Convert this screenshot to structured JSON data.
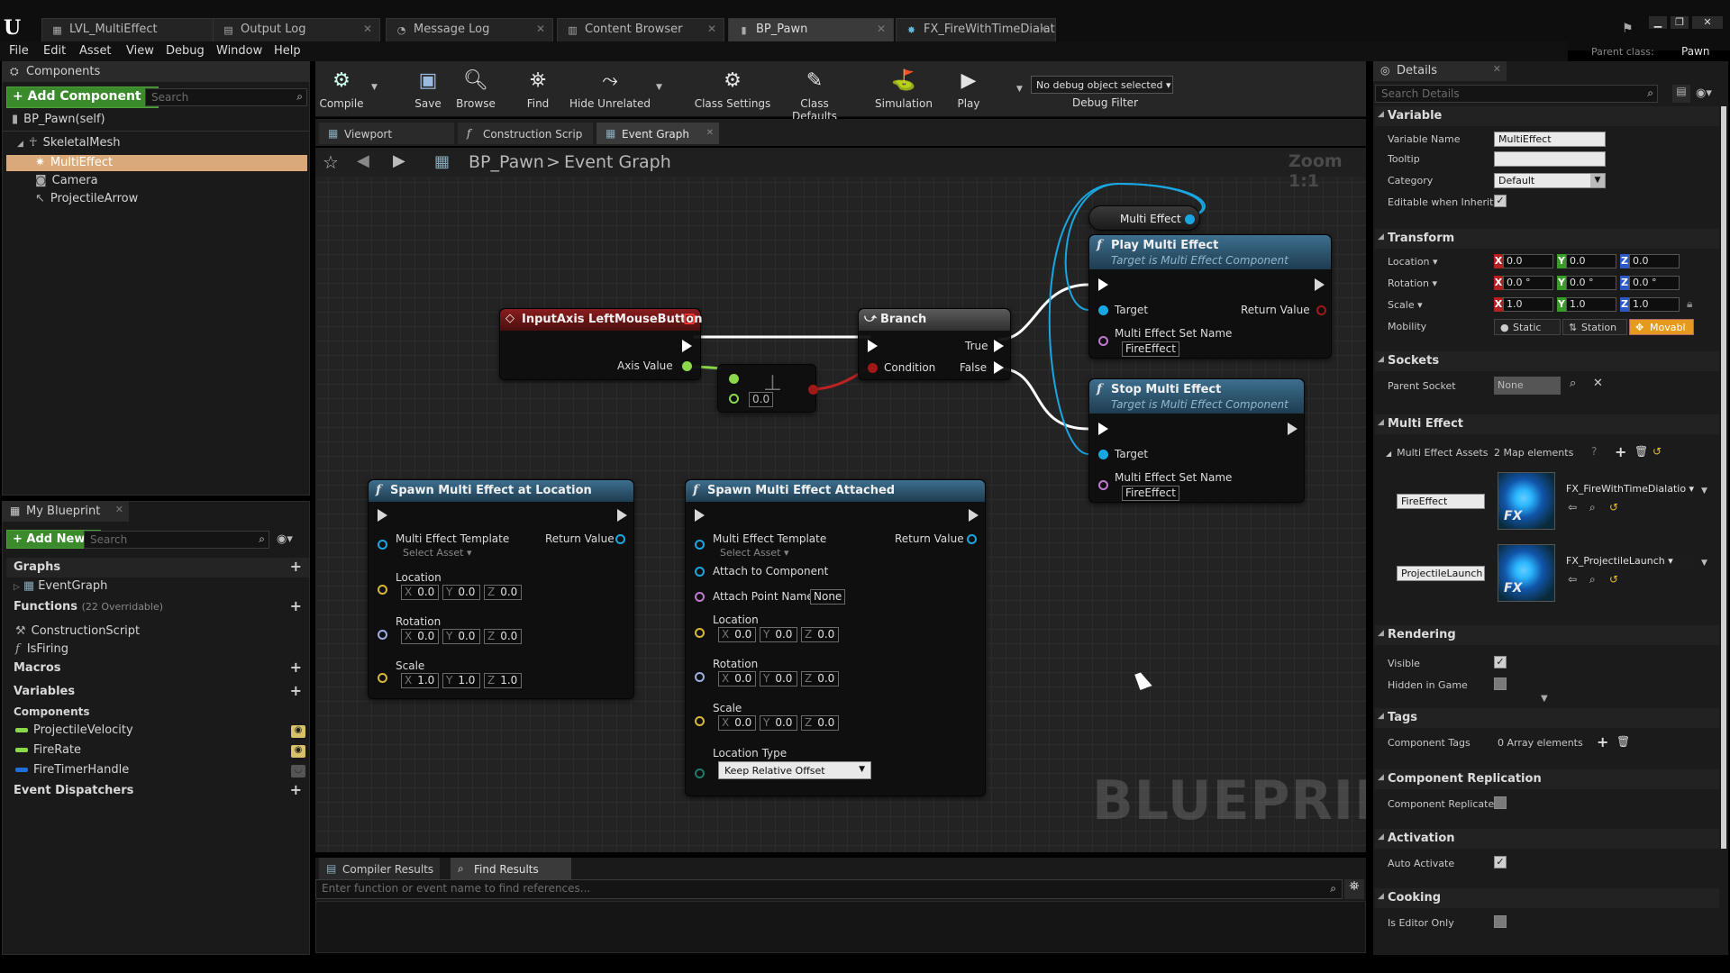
{
  "titlebar": {
    "logo": "U",
    "parent_label": "Parent class:",
    "parent_value": "Pawn",
    "tabs": [
      {
        "label": "LVL_MultiEffect",
        "icon": "level-icon"
      },
      {
        "label": "Output Log",
        "icon": "log-icon"
      },
      {
        "label": "Message Log",
        "icon": "message-log-icon"
      },
      {
        "label": "Content Browser",
        "icon": "content-browser-icon"
      },
      {
        "label": "BP_Pawn",
        "icon": "blueprint-icon"
      },
      {
        "label": "FX_FireWithTimeDialation",
        "icon": "fx-icon"
      }
    ]
  },
  "menu": [
    "File",
    "Edit",
    "Asset",
    "View",
    "Debug",
    "Window",
    "Help"
  ],
  "components": {
    "header": "Components",
    "add_button": "+ Add Component ▾",
    "search_placeholder": "Search",
    "self": "BP_Pawn(self)",
    "tree": [
      "SkeletalMesh",
      "MultiEffect",
      "Camera",
      "ProjectileArrow"
    ]
  },
  "my_blueprint": {
    "header": "My Blueprint",
    "add_button": "+ Add New ▾",
    "search_placeholder": "Search",
    "graphs_label": "Graphs",
    "event_graph": "EventGraph",
    "functions_label": "Functions",
    "functions_note": "(22 Overridable)",
    "functions": [
      "ConstructionScript",
      "IsFiring"
    ],
    "macros_label": "Macros",
    "variables_label": "Variables",
    "components_label": "Components",
    "vars": [
      "ProjectileVelocity",
      "FireRate",
      "FireTimerHandle"
    ],
    "dispatchers_label": "Event Dispatchers",
    "colors": {
      "float": "#8bd94a",
      "vector": "#d7b83a",
      "struct": "#1f6fd6"
    }
  },
  "toolbar": {
    "compile": "Compile",
    "save": "Save",
    "browse": "Browse",
    "find": "Find",
    "hide_unrelated": "Hide Unrelated",
    "class_settings": "Class Settings",
    "class_defaults": "Class Defaults",
    "simulation": "Simulation",
    "play": "Play",
    "debug_select": "No debug object selected ▾",
    "debug_filter": "Debug Filter"
  },
  "editor_tabs": [
    "Viewport",
    "Construction Scrip",
    "Event Graph"
  ],
  "graph": {
    "breadcrumb_root": "BP_Pawn",
    "breadcrumb_sep": ">",
    "breadcrumb_leaf": "Event Graph",
    "zoom": "Zoom 1:1",
    "watermark": "BLUEPRINT",
    "input_node": {
      "title": "InputAxis LeftMouseButton",
      "axis_value": "Axis Value"
    },
    "compare_node": {
      "value": "0.0"
    },
    "branch_node": {
      "title": "Branch",
      "true_label": "True",
      "false_label": "False",
      "condition": "Condition"
    },
    "getter_node": {
      "label": "Multi Effect"
    },
    "play_node": {
      "title": "Play Multi Effect",
      "subtitle": "Target is Multi Effect Component",
      "target": "Target",
      "return_value": "Return Value",
      "set_name": "Multi Effect Set Name",
      "set_value": "FireEffect"
    },
    "stop_node": {
      "title": "Stop Multi Effect",
      "subtitle": "Target is Multi Effect Component",
      "target": "Target",
      "set_name": "Multi Effect Set Name",
      "set_value": "FireEffect"
    },
    "spawn_loc_node": {
      "title": "Spawn Multi Effect at Location",
      "template": "Multi Effect Template",
      "select_asset": "Select Asset ▾",
      "return_value": "Return Value",
      "location": "Location",
      "rotation": "Rotation",
      "scale": "Scale",
      "loc": [
        "0.0",
        "0.0",
        "0.0"
      ],
      "rot": [
        "0.0",
        "0.0",
        "0.0"
      ],
      "scl": [
        "1.0",
        "1.0",
        "1.0"
      ]
    },
    "spawn_att_node": {
      "title": "Spawn Multi Effect Attached",
      "template": "Multi Effect Template",
      "select_asset": "Select Asset ▾",
      "return_value": "Return Value",
      "attach_to": "Attach to Component",
      "attach_point": "Attach Point Name",
      "attach_point_value": "None",
      "location": "Location",
      "rotation": "Rotation",
      "scale": "Scale",
      "loc": [
        "0.0",
        "0.0",
        "0.0"
      ],
      "rot": [
        "0.0",
        "0.0",
        "0.0"
      ],
      "scl": [
        "0.0",
        "0.0",
        "0.0"
      ],
      "location_type": "Location Type",
      "location_type_value": "Keep Relative Offset"
    },
    "axis": {
      "x": "X",
      "y": "Y",
      "z": "Z"
    }
  },
  "bottom": {
    "tabs": [
      "Compiler Results",
      "Find Results"
    ],
    "find_placeholder": "Enter function or event name to find references..."
  },
  "details": {
    "header": "Details",
    "search_placeholder": "Search Details",
    "variable": {
      "section": "Variable",
      "name_label": "Variable Name",
      "name_value": "MultiEffect",
      "tooltip_label": "Tooltip",
      "category_label": "Category",
      "category_value": "Default",
      "editable_label": "Editable when Inherited"
    },
    "transform": {
      "section": "Transform",
      "location_label": "Location ▾",
      "rotation_label": "Rotation ▾",
      "scale_label": "Scale ▾",
      "mobility_label": "Mobility",
      "loc": [
        "0.0",
        "0.0",
        "0.0"
      ],
      "rot": [
        "0.0 °",
        "0.0 °",
        "0.0 °"
      ],
      "scl": [
        "1.0",
        "1.0",
        "1.0"
      ],
      "mob": [
        "Static",
        "Station",
        "Movabl"
      ]
    },
    "sockets": {
      "section": "Sockets",
      "parent_label": "Parent Socket",
      "parent_value": "None"
    },
    "multi_effect": {
      "section": "Multi Effect",
      "assets_label": "Multi Effect Assets",
      "assets_count": "2 Map elements",
      "entries": [
        {
          "key": "FireEffect",
          "asset": "FX_FireWithTimeDialatio ▾"
        },
        {
          "key": "ProjectileLaunch",
          "asset": "FX_ProjectileLaunch ▾"
        }
      ],
      "thumb_label": "FX"
    },
    "rendering": {
      "section": "Rendering",
      "visible_label": "Visible",
      "hidden_label": "Hidden in Game"
    },
    "tags": {
      "section": "Tags",
      "label": "Component Tags",
      "value": "0 Array elements"
    },
    "replication": {
      "section": "Component Replication",
      "label": "Component Replicates"
    },
    "activation": {
      "section": "Activation",
      "label": "Auto Activate"
    },
    "cooking": {
      "section": "Cooking",
      "label": "Is Editor Only"
    }
  }
}
